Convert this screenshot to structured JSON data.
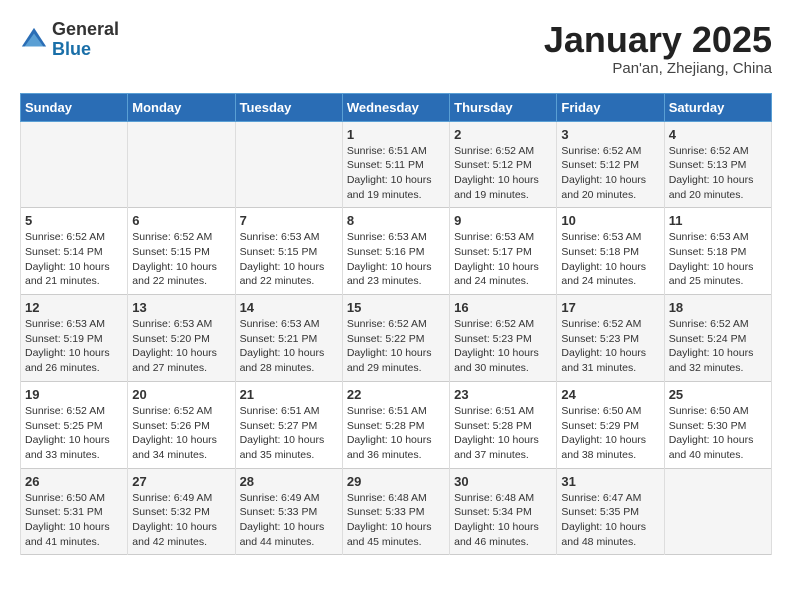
{
  "header": {
    "logo_general": "General",
    "logo_blue": "Blue",
    "month_title": "January 2025",
    "location": "Pan'an, Zhejiang, China"
  },
  "days_of_week": [
    "Sunday",
    "Monday",
    "Tuesday",
    "Wednesday",
    "Thursday",
    "Friday",
    "Saturday"
  ],
  "weeks": [
    [
      {
        "day": "",
        "info": ""
      },
      {
        "day": "",
        "info": ""
      },
      {
        "day": "",
        "info": ""
      },
      {
        "day": "1",
        "info": "Sunrise: 6:51 AM\nSunset: 5:11 PM\nDaylight: 10 hours\nand 19 minutes."
      },
      {
        "day": "2",
        "info": "Sunrise: 6:52 AM\nSunset: 5:12 PM\nDaylight: 10 hours\nand 19 minutes."
      },
      {
        "day": "3",
        "info": "Sunrise: 6:52 AM\nSunset: 5:12 PM\nDaylight: 10 hours\nand 20 minutes."
      },
      {
        "day": "4",
        "info": "Sunrise: 6:52 AM\nSunset: 5:13 PM\nDaylight: 10 hours\nand 20 minutes."
      }
    ],
    [
      {
        "day": "5",
        "info": "Sunrise: 6:52 AM\nSunset: 5:14 PM\nDaylight: 10 hours\nand 21 minutes."
      },
      {
        "day": "6",
        "info": "Sunrise: 6:52 AM\nSunset: 5:15 PM\nDaylight: 10 hours\nand 22 minutes."
      },
      {
        "day": "7",
        "info": "Sunrise: 6:53 AM\nSunset: 5:15 PM\nDaylight: 10 hours\nand 22 minutes."
      },
      {
        "day": "8",
        "info": "Sunrise: 6:53 AM\nSunset: 5:16 PM\nDaylight: 10 hours\nand 23 minutes."
      },
      {
        "day": "9",
        "info": "Sunrise: 6:53 AM\nSunset: 5:17 PM\nDaylight: 10 hours\nand 24 minutes."
      },
      {
        "day": "10",
        "info": "Sunrise: 6:53 AM\nSunset: 5:18 PM\nDaylight: 10 hours\nand 24 minutes."
      },
      {
        "day": "11",
        "info": "Sunrise: 6:53 AM\nSunset: 5:18 PM\nDaylight: 10 hours\nand 25 minutes."
      }
    ],
    [
      {
        "day": "12",
        "info": "Sunrise: 6:53 AM\nSunset: 5:19 PM\nDaylight: 10 hours\nand 26 minutes."
      },
      {
        "day": "13",
        "info": "Sunrise: 6:53 AM\nSunset: 5:20 PM\nDaylight: 10 hours\nand 27 minutes."
      },
      {
        "day": "14",
        "info": "Sunrise: 6:53 AM\nSunset: 5:21 PM\nDaylight: 10 hours\nand 28 minutes."
      },
      {
        "day": "15",
        "info": "Sunrise: 6:52 AM\nSunset: 5:22 PM\nDaylight: 10 hours\nand 29 minutes."
      },
      {
        "day": "16",
        "info": "Sunrise: 6:52 AM\nSunset: 5:23 PM\nDaylight: 10 hours\nand 30 minutes."
      },
      {
        "day": "17",
        "info": "Sunrise: 6:52 AM\nSunset: 5:23 PM\nDaylight: 10 hours\nand 31 minutes."
      },
      {
        "day": "18",
        "info": "Sunrise: 6:52 AM\nSunset: 5:24 PM\nDaylight: 10 hours\nand 32 minutes."
      }
    ],
    [
      {
        "day": "19",
        "info": "Sunrise: 6:52 AM\nSunset: 5:25 PM\nDaylight: 10 hours\nand 33 minutes."
      },
      {
        "day": "20",
        "info": "Sunrise: 6:52 AM\nSunset: 5:26 PM\nDaylight: 10 hours\nand 34 minutes."
      },
      {
        "day": "21",
        "info": "Sunrise: 6:51 AM\nSunset: 5:27 PM\nDaylight: 10 hours\nand 35 minutes."
      },
      {
        "day": "22",
        "info": "Sunrise: 6:51 AM\nSunset: 5:28 PM\nDaylight: 10 hours\nand 36 minutes."
      },
      {
        "day": "23",
        "info": "Sunrise: 6:51 AM\nSunset: 5:28 PM\nDaylight: 10 hours\nand 37 minutes."
      },
      {
        "day": "24",
        "info": "Sunrise: 6:50 AM\nSunset: 5:29 PM\nDaylight: 10 hours\nand 38 minutes."
      },
      {
        "day": "25",
        "info": "Sunrise: 6:50 AM\nSunset: 5:30 PM\nDaylight: 10 hours\nand 40 minutes."
      }
    ],
    [
      {
        "day": "26",
        "info": "Sunrise: 6:50 AM\nSunset: 5:31 PM\nDaylight: 10 hours\nand 41 minutes."
      },
      {
        "day": "27",
        "info": "Sunrise: 6:49 AM\nSunset: 5:32 PM\nDaylight: 10 hours\nand 42 minutes."
      },
      {
        "day": "28",
        "info": "Sunrise: 6:49 AM\nSunset: 5:33 PM\nDaylight: 10 hours\nand 44 minutes."
      },
      {
        "day": "29",
        "info": "Sunrise: 6:48 AM\nSunset: 5:33 PM\nDaylight: 10 hours\nand 45 minutes."
      },
      {
        "day": "30",
        "info": "Sunrise: 6:48 AM\nSunset: 5:34 PM\nDaylight: 10 hours\nand 46 minutes."
      },
      {
        "day": "31",
        "info": "Sunrise: 6:47 AM\nSunset: 5:35 PM\nDaylight: 10 hours\nand 48 minutes."
      },
      {
        "day": "",
        "info": ""
      }
    ]
  ]
}
